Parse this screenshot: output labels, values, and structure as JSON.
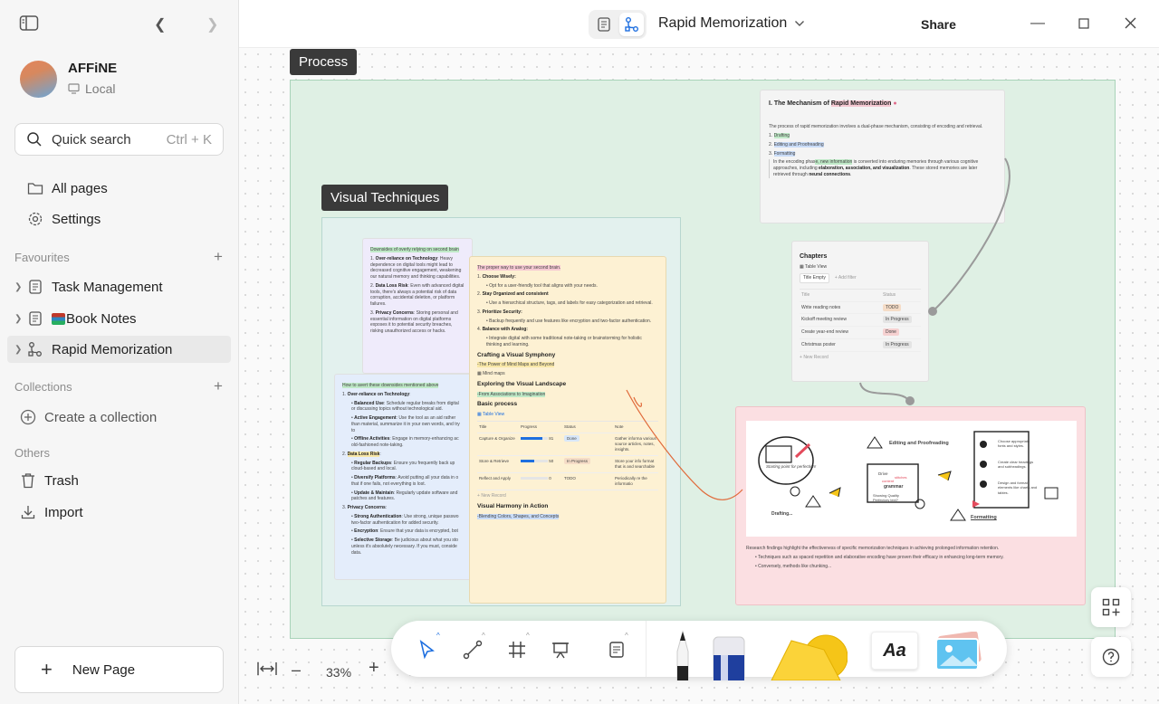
{
  "sidebar": {
    "workspace": {
      "name": "AFFiNE",
      "sub": "Local"
    },
    "search": {
      "label": "Quick search",
      "shortcut": "Ctrl + K"
    },
    "nav": {
      "all_pages": "All pages",
      "settings": "Settings"
    },
    "favourites": {
      "title": "Favourites",
      "items": [
        "Task Management",
        "Book Notes",
        "Rapid Memorization"
      ]
    },
    "collections": {
      "title": "Collections",
      "create": "Create a collection"
    },
    "others": {
      "title": "Others",
      "trash": "Trash",
      "import": "Import"
    },
    "new_page": "New Page"
  },
  "topbar": {
    "title": "Rapid Memorization",
    "share": "Share"
  },
  "canvas": {
    "frame_process": "Process",
    "frame_visual": "Visual Techniques",
    "zoom": "33%",
    "note_purple": {
      "title": "Downsides of overly relying on second brain",
      "items": [
        {
          "head": "Over-reliance on Technology",
          "text": ": Heavy dependence on digital tools might lead to decreased cognitive engagement, weakening our natural memory and thinking capabilities."
        },
        {
          "head": "Data Loss Risk",
          "text": ": Even with advanced digital tools, there's always a potential risk of data corruption, accidental deletion, or platform failures."
        },
        {
          "head": "Privacy Concerns",
          "text": ": Storing personal and essential information on digital platforms exposes it to potential security breaches, risking unauthorized access or hacks."
        }
      ]
    },
    "note_blue": {
      "title": "How to avert these downsides mentioned above",
      "h1": "Over-reliance on Technology",
      "s1": [
        {
          "head": "Balanced Use",
          "text": ": Schedule regular breaks from digital or discussing topics without technological aid."
        },
        {
          "head": "Active Engagement",
          "text": ": Use the tool as an aid rather than material, summarize it in your own words, and try to"
        },
        {
          "head": "Offline Activities",
          "text": ": Engage in memory-enhancing ac old-fashioned note-taking."
        }
      ],
      "h2": "Data Loss Risk",
      "s2": [
        {
          "head": "Regular Backups",
          "text": ": Ensure you frequently back up cloud-based and local."
        },
        {
          "head": "Diversify Platforms",
          "text": ": Avoid putting all your data in o that if one fails, not everything is lost."
        },
        {
          "head": "Update & Maintain",
          "text": ": Regularly update software and patches and features."
        }
      ],
      "h3": "Privacy Concerns",
      "s3": [
        {
          "head": "Strong Authentication",
          "text": ": Use strong, unique passwo two-factor authentication for added security."
        },
        {
          "head": "Encryption",
          "text": ": Ensure that your data is encrypted, bot"
        },
        {
          "head": "Selective Storage",
          "text": ": Be judicious about what you sto unless it's absolutely necessary. If you must, conside data."
        }
      ]
    },
    "note_yellow": {
      "title": "The proper way to use your second brain.",
      "items": [
        {
          "head": "Choose Wisely:",
          "sub": "Opt for a user-friendly tool that aligns with your needs."
        },
        {
          "head": "Stay Organized and consistent",
          "sub": "Use a hierarchical structure, tags, and labels for easy categorization and retrieval."
        },
        {
          "head": "Prioritize Security:",
          "sub": "Backup frequently and use features like encryption and two-factor authentication."
        },
        {
          "head": "Balance with Analog:",
          "sub": "Integrate digital with some traditional note-taking or brainstorming for holistic thinking and learning."
        }
      ],
      "h_symphony": "Crafting a Visual Symphony",
      "symphony_sub": "-The Power of Mind Maps and Beyond",
      "mind_maps": "Mind maps",
      "h_landscape": "Exploring the Visual Landscape",
      "landscape_sub": "-From Associations to Imagination",
      "basic_process": "Basic process",
      "table_view": "Table View",
      "table_headers": [
        "Title",
        "Progress",
        "Status",
        "Note"
      ],
      "table_rows": [
        {
          "title": "Capture & Organize",
          "progress": "81",
          "status": "Done",
          "note": "Gather informa various source articles, notes, insights."
        },
        {
          "title": "Store & Retrieve",
          "progress": "50",
          "status": "In Progress",
          "note": "Store your info format that is and searchable"
        },
        {
          "title": "Reflect and Apply",
          "progress": "0",
          "status": "TODO",
          "note": "Periodically re the informatio"
        }
      ],
      "new_record": "New Record",
      "h_harmony": "Visual Harmony in Action",
      "harmony_sub": "-Blending Colors, Shapes, and Concepts"
    },
    "note_mechanism": {
      "title_prefix": "I. The Mechanism of ",
      "title_hl": "Rapid Memorization",
      "intro": "The process of rapid memorization involves a dual-phase mechanism, consisting of encoding and retrieval.",
      "steps": [
        "Drafting",
        "Editing and Proofreading",
        "Formatting"
      ],
      "para_a": "In the encoding phas",
      "para_hl": "e, new information",
      "para_b": " is converted into enduring memories through various cognitive approaches, including ",
      "para_bold": "elaboration, association, and visualization",
      "para_c": ". These stored memories are later retrieved through ",
      "para_bold2": "neural connections",
      "para_end": "."
    },
    "note_chapters": {
      "title": "Chapters",
      "view": "Table View",
      "filter_a": "Title",
      "filter_b": "Empty",
      "add_filter": "Add filter",
      "headers": [
        "Title",
        "Status"
      ],
      "rows": [
        {
          "title": "Write reading notes",
          "status": "TODO"
        },
        {
          "title": "Kickoff meeting review",
          "status": "In Progress"
        },
        {
          "title": "Create year-end review",
          "status": "Done"
        },
        {
          "title": "Christmas poster",
          "status": "In Progress"
        }
      ],
      "new_record": "New Record"
    },
    "note_pink": {
      "sketch_labels": [
        "Starting point for perfection!",
        "Drafting...",
        "Editing and Proofreading",
        "Drive",
        "content",
        "stitches",
        "grammar",
        "Showing Quality Perfectory text?",
        "Formatting",
        "Choose appropriate fonts and styles.",
        "Create clear headings and subheadings.",
        "Design and format elements like charts and tables."
      ],
      "line1": "Research findings highlight the effectiveness of specific memorization techniques in achieving prolonged information retention.",
      "line2": "Techniques such as spaced repetition and elaborative encoding have proven their efficacy in enhancing long-term memory.",
      "line3": "Conversely, methods like chunking..."
    },
    "toolbar": {
      "text_tool": "Aa"
    }
  }
}
